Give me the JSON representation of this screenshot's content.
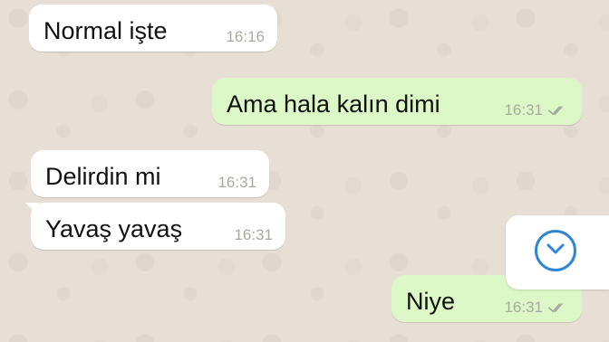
{
  "messages": [
    {
      "id": 1,
      "direction": "incoming",
      "text": "Normal işte",
      "time": "16:16"
    },
    {
      "id": 2,
      "direction": "outgoing",
      "text": "Ama hala kalın dimi",
      "time": "16:31",
      "status_icon": "double-check-icon"
    },
    {
      "id": 3,
      "direction": "incoming",
      "text": "Delirdin mi",
      "time": "16:31"
    },
    {
      "id": 4,
      "direction": "incoming",
      "text": "Yavaş yavaş",
      "time": "16:31"
    },
    {
      "id": 5,
      "direction": "outgoing",
      "text": "Niye",
      "time": "16:31",
      "status_icon": "double-check-icon"
    }
  ],
  "scroll_button": {
    "icon": "chevron-down-icon",
    "accent": "#2f86d9"
  },
  "colors": {
    "incoming_bubble": "#ffffff",
    "outgoing_bubble": "#dcf8c6",
    "time_text": "#a7aaa0",
    "wallpaper": "#e7dfd5"
  }
}
